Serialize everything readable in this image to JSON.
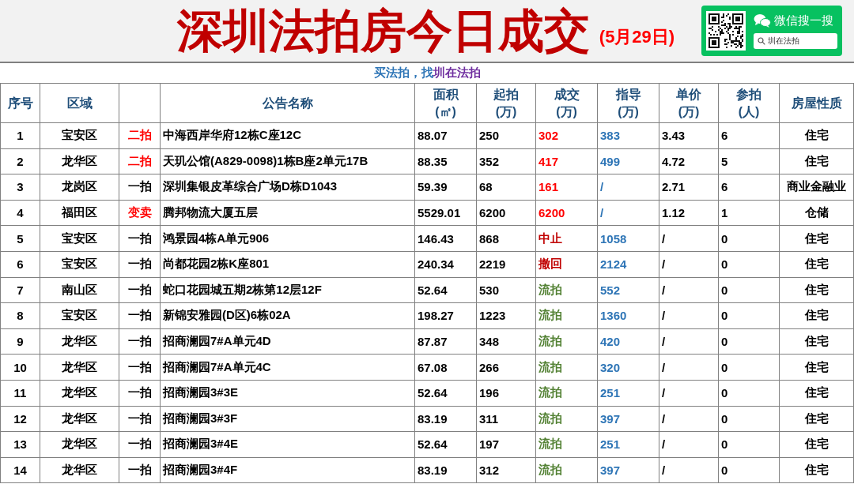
{
  "banner": {
    "title": "深圳法拍房今日成交",
    "date": "(5月29日)",
    "promo": {
      "caption": "微信搜一搜",
      "search_text": "圳在法拍"
    }
  },
  "slogan": [
    {
      "text": "买法拍，找",
      "color": "#2e75b6"
    },
    {
      "text": "圳在法拍",
      "color": "#7030a0"
    }
  ],
  "table": {
    "columns": [
      {
        "label": "序号"
      },
      {
        "label": "区域"
      },
      {},
      {
        "label": "公告名称"
      },
      {
        "label": "面积",
        "unit": "(㎡)"
      },
      {
        "label": "起拍",
        "unit": "(万)"
      },
      {
        "label": "成交",
        "unit": "(万)"
      },
      {
        "label": "指导",
        "unit": "(万)"
      },
      {
        "label": "单价",
        "unit": "(万)"
      },
      {
        "label": "参拍",
        "unit": "(人)"
      },
      {
        "label": "房屋性质"
      }
    ],
    "rows": [
      {
        "no": "1",
        "district": "宝安区",
        "round": {
          "text": "二拍",
          "color": "#ff0000"
        },
        "name": "中海西岸华府12栋C座12C",
        "area": "88.07",
        "start": "250",
        "deal": {
          "text": "302",
          "color": "#ff0000"
        },
        "guide": "383",
        "unit_price": "3.43",
        "bidders": "6",
        "type": "住宅"
      },
      {
        "no": "2",
        "district": "龙华区",
        "round": {
          "text": "二拍",
          "color": "#ff0000"
        },
        "name": "天玑公馆(A829-0098)1栋B座2单元17B",
        "area": "88.35",
        "start": "352",
        "deal": {
          "text": "417",
          "color": "#ff0000"
        },
        "guide": "499",
        "unit_price": "4.72",
        "bidders": "5",
        "type": "住宅"
      },
      {
        "no": "3",
        "district": "龙岗区",
        "round": {
          "text": "一拍",
          "color": "#000000"
        },
        "name": "深圳集银皮革综合广场D栋D1043",
        "area": "59.39",
        "start": "68",
        "deal": {
          "text": "161",
          "color": "#ff0000"
        },
        "guide": "/",
        "unit_price": "2.71",
        "bidders": "6",
        "type": "商业金融业"
      },
      {
        "no": "4",
        "district": "福田区",
        "round": {
          "text": "变卖",
          "color": "#ff0000"
        },
        "name": "腾邦物流大厦五层",
        "area": "5529.01",
        "start": "6200",
        "deal": {
          "text": "6200",
          "color": "#ff0000"
        },
        "guide": "/",
        "unit_price": "1.12",
        "bidders": "1",
        "type": "仓储"
      },
      {
        "no": "5",
        "district": "宝安区",
        "round": {
          "text": "一拍",
          "color": "#000000"
        },
        "name": "鸿景园4栋A单元906",
        "area": "146.43",
        "start": "868",
        "deal": {
          "text": "中止",
          "color": "#c00000"
        },
        "guide": "1058",
        "unit_price": "/",
        "bidders": "0",
        "type": "住宅"
      },
      {
        "no": "6",
        "district": "宝安区",
        "round": {
          "text": "一拍",
          "color": "#000000"
        },
        "name": "尚都花园2栋K座801",
        "area": "240.34",
        "start": "2219",
        "deal": {
          "text": "撤回",
          "color": "#c00000"
        },
        "guide": "2124",
        "unit_price": "/",
        "bidders": "0",
        "type": "住宅"
      },
      {
        "no": "7",
        "district": "南山区",
        "round": {
          "text": "一拍",
          "color": "#000000"
        },
        "name": "蛇口花园城五期2栋第12层12F",
        "area": "52.64",
        "start": "530",
        "deal": {
          "text": "流拍",
          "color": "#548235"
        },
        "guide": "552",
        "unit_price": "/",
        "bidders": "0",
        "type": "住宅"
      },
      {
        "no": "8",
        "district": "宝安区",
        "round": {
          "text": "一拍",
          "color": "#000000"
        },
        "name": "新锦安雅园(D区)6栋02A",
        "area": "198.27",
        "start": "1223",
        "deal": {
          "text": "流拍",
          "color": "#548235"
        },
        "guide": "1360",
        "unit_price": "/",
        "bidders": "0",
        "type": "住宅"
      },
      {
        "no": "9",
        "district": "龙华区",
        "round": {
          "text": "一拍",
          "color": "#000000"
        },
        "name": "招商澜园7#A单元4D",
        "area": "87.87",
        "start": "348",
        "deal": {
          "text": "流拍",
          "color": "#548235"
        },
        "guide": "420",
        "unit_price": "/",
        "bidders": "0",
        "type": "住宅"
      },
      {
        "no": "10",
        "district": "龙华区",
        "round": {
          "text": "一拍",
          "color": "#000000"
        },
        "name": "招商澜园7#A单元4C",
        "area": "67.08",
        "start": "266",
        "deal": {
          "text": "流拍",
          "color": "#548235"
        },
        "guide": "320",
        "unit_price": "/",
        "bidders": "0",
        "type": "住宅"
      },
      {
        "no": "11",
        "district": "龙华区",
        "round": {
          "text": "一拍",
          "color": "#000000"
        },
        "name": "招商澜园3#3E",
        "area": "52.64",
        "start": "196",
        "deal": {
          "text": "流拍",
          "color": "#548235"
        },
        "guide": "251",
        "unit_price": "/",
        "bidders": "0",
        "type": "住宅"
      },
      {
        "no": "12",
        "district": "龙华区",
        "round": {
          "text": "一拍",
          "color": "#000000"
        },
        "name": "招商澜园3#3F",
        "area": "83.19",
        "start": "311",
        "deal": {
          "text": "流拍",
          "color": "#548235"
        },
        "guide": "397",
        "unit_price": "/",
        "bidders": "0",
        "type": "住宅"
      },
      {
        "no": "13",
        "district": "龙华区",
        "round": {
          "text": "一拍",
          "color": "#000000"
        },
        "name": "招商澜园3#4E",
        "area": "52.64",
        "start": "197",
        "deal": {
          "text": "流拍",
          "color": "#548235"
        },
        "guide": "251",
        "unit_price": "/",
        "bidders": "0",
        "type": "住宅"
      },
      {
        "no": "14",
        "district": "龙华区",
        "round": {
          "text": "一拍",
          "color": "#000000"
        },
        "name": "招商澜园3#4F",
        "area": "83.19",
        "start": "312",
        "deal": {
          "text": "流拍",
          "color": "#548235"
        },
        "guide": "397",
        "unit_price": "/",
        "bidders": "0",
        "type": "住宅"
      }
    ]
  }
}
